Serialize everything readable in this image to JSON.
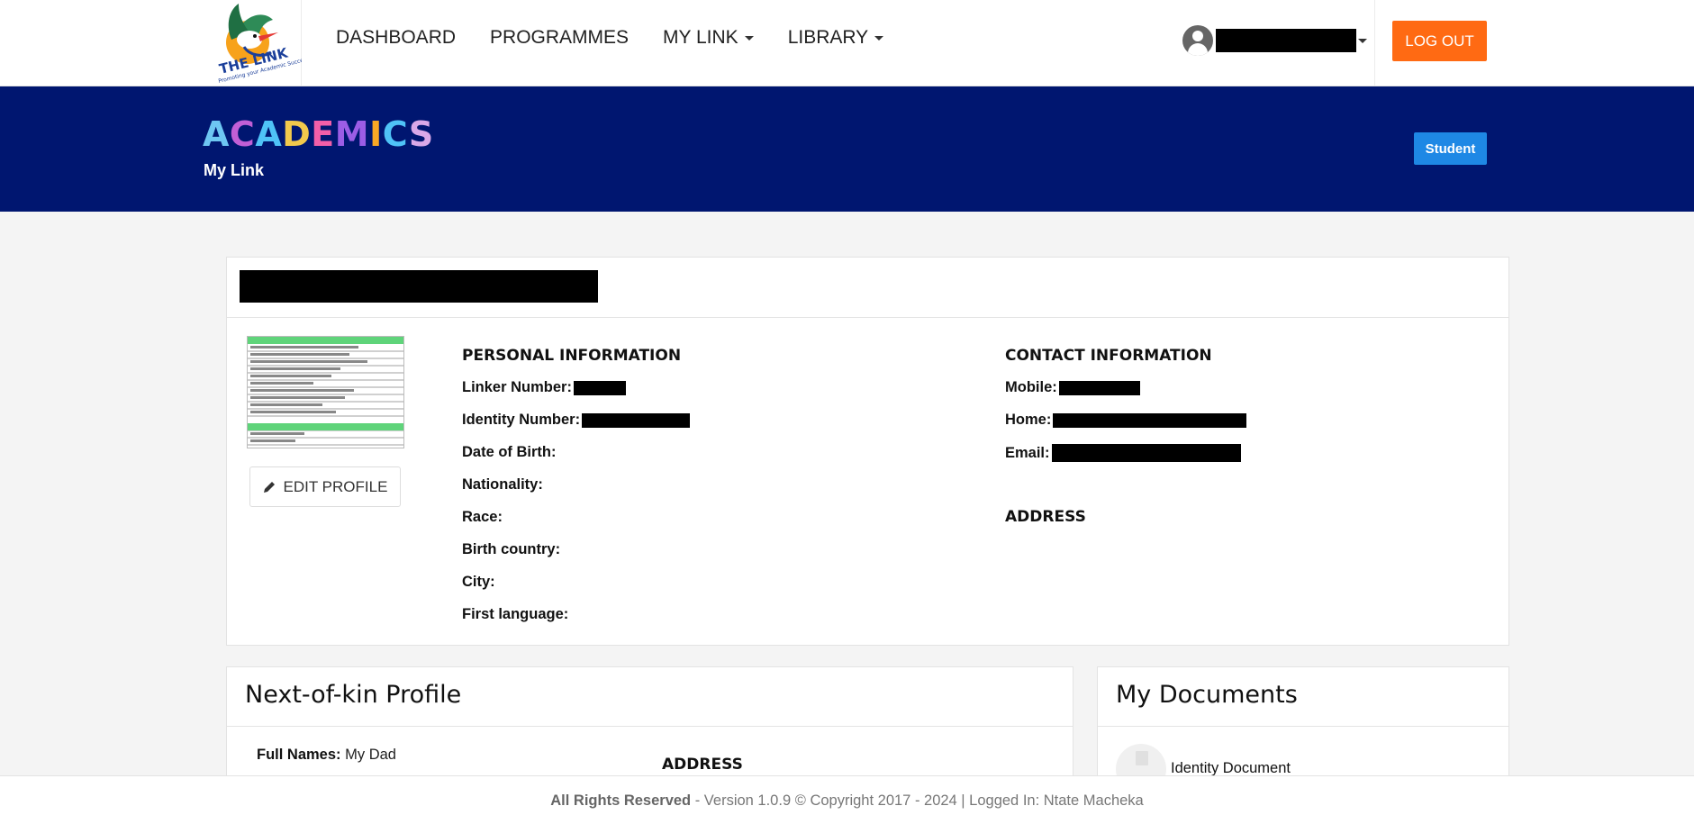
{
  "nav": {
    "items": [
      {
        "label": "DASHBOARD",
        "dropdown": false
      },
      {
        "label": "PROGRAMMES",
        "dropdown": false
      },
      {
        "label": "MY LINK",
        "dropdown": true
      },
      {
        "label": "LIBRARY",
        "dropdown": true
      }
    ],
    "logout_label": "LOG OUT",
    "logo_text": "THE LINK",
    "logo_tagline": "Promoting your Academic Success"
  },
  "banner": {
    "title": "ACADEMICS",
    "title_colors": [
      "#6ec6f2",
      "#c15fd6",
      "#4fc3f7",
      "#f2c94c",
      "#f25fa9",
      "#9b5de5",
      "#f9a825",
      "#4fc3f7",
      "#d9a8e8"
    ],
    "subtitle": "My Link",
    "role_badge": "Student"
  },
  "profile": {
    "edit_label": "EDIT PROFILE",
    "personal": {
      "title": "PERSONAL INFORMATION",
      "fields": [
        {
          "label": "Linker Number:"
        },
        {
          "label": "Identity Number:"
        },
        {
          "label": "Date of Birth:"
        },
        {
          "label": "Nationality:"
        },
        {
          "label": "Race:"
        },
        {
          "label": "Birth country:"
        },
        {
          "label": "City:"
        },
        {
          "label": "First language:"
        }
      ]
    },
    "contact": {
      "title": "CONTACT INFORMATION",
      "fields": [
        {
          "label": "Mobile:"
        },
        {
          "label": "Home:"
        },
        {
          "label": "Email:"
        }
      ],
      "address_title": "ADDRESS"
    }
  },
  "kin": {
    "title": "Next-of-kin Profile",
    "full_names_label": "Full Names:",
    "full_names_value": "My Dad",
    "address_title": "ADDRESS"
  },
  "documents": {
    "title": "My Documents",
    "items": [
      "Identity Document"
    ]
  },
  "footer": {
    "bold": "All Rights Reserved",
    "text": " - Version 1.0.9 © Copyright 2017 - 2024 | Logged In: Ntate Macheka"
  },
  "colors": {
    "banner_bg": "#001670",
    "logout_bg": "#ff6a13",
    "badge_bg": "#1e88e5"
  }
}
